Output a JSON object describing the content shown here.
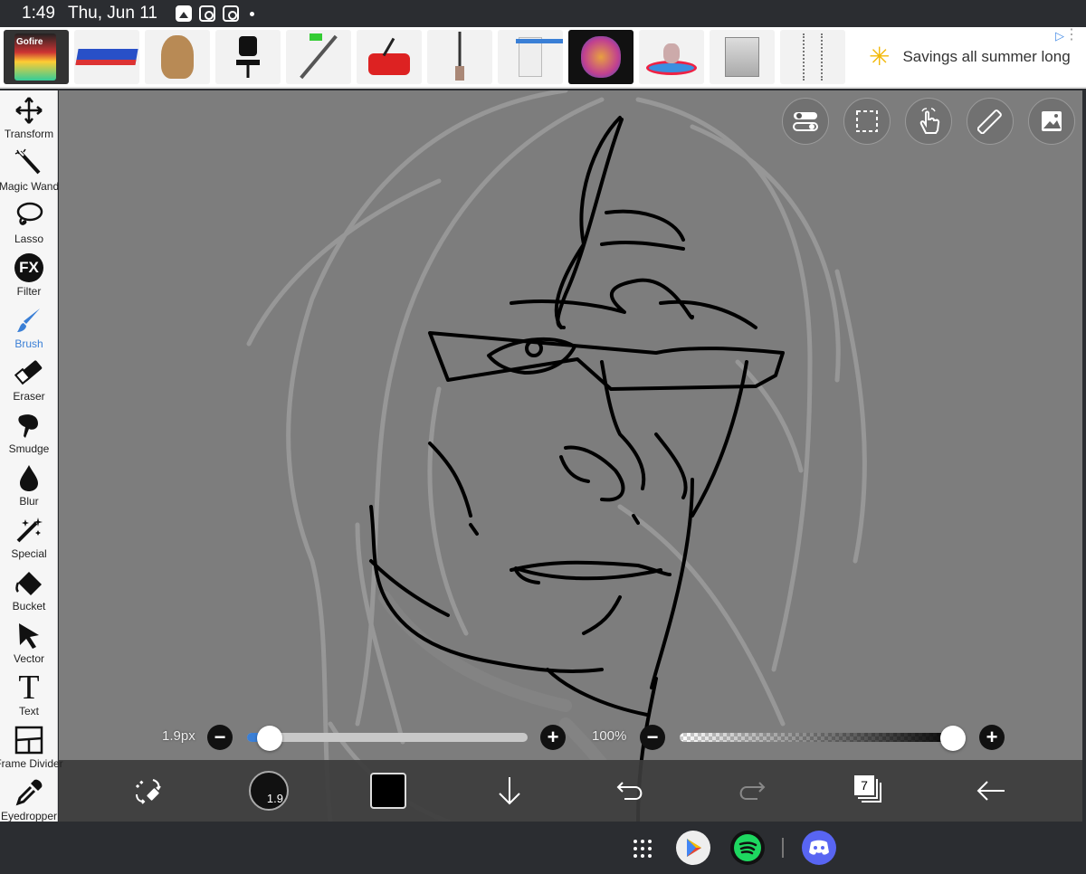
{
  "status_bar": {
    "time": "1:49",
    "date": "Thu, Jun 11",
    "icons": [
      "gallery-icon",
      "instagram-icon",
      "instagram-icon",
      "notification-dot-icon"
    ]
  },
  "ad_banner": {
    "products": [
      "phone-case-icon",
      "cot-icon",
      "dog-plush-icon",
      "office-chair-icon",
      "string-trimmer-icon",
      "lawn-mower-icon",
      "broom-icon",
      "water-dispenser-icon",
      "dog-art-icon",
      "swing-icon",
      "air-purifier-icon",
      "wind-chime-icon"
    ],
    "thumb_label": "Gofire",
    "slogan": "Savings all summer long",
    "brand_icon": "walmart-spark-icon",
    "info_icon": "ad-choices-icon"
  },
  "tools": [
    {
      "label": "Transform",
      "icon": "transform-icon"
    },
    {
      "label": "Magic Wand",
      "icon": "magic-wand-icon"
    },
    {
      "label": "Lasso",
      "icon": "lasso-icon"
    },
    {
      "label": "Filter",
      "icon": "fx-icon",
      "glyph": "FX"
    },
    {
      "label": "Brush",
      "icon": "brush-icon"
    },
    {
      "label": "Eraser",
      "icon": "eraser-icon"
    },
    {
      "label": "Smudge",
      "icon": "smudge-icon"
    },
    {
      "label": "Blur",
      "icon": "blur-drop-icon"
    },
    {
      "label": "Special",
      "icon": "special-icon"
    },
    {
      "label": "Bucket",
      "icon": "bucket-icon"
    },
    {
      "label": "Vector",
      "icon": "vector-arrow-icon"
    },
    {
      "label": "Text",
      "icon": "text-icon",
      "glyph": "T"
    },
    {
      "label": "Frame Divider",
      "icon": "frame-divider-icon"
    },
    {
      "label": "Eyedropper",
      "icon": "eyedropper-icon"
    }
  ],
  "active_tool": "Brush",
  "canvas_controls": [
    "toggle-icon",
    "selection-icon",
    "hand-touch-icon",
    "ruler-icon",
    "reference-image-icon"
  ],
  "brush_size": {
    "label": "1.9px",
    "value_fraction": 0.06
  },
  "opacity": {
    "label": "100%",
    "value_fraction": 1.0
  },
  "bottom_bar": {
    "brush_preview_value": "1.9",
    "color": "#000000",
    "layer_count": "7",
    "buttons": [
      "swap-eraser-icon",
      "brush-size-preview-icon",
      "color-swatch-icon",
      "download-arrow-icon",
      "undo-icon",
      "redo-icon",
      "layers-icon",
      "back-arrow-icon"
    ]
  },
  "nav_apps": [
    "app-grid-icon",
    "play-store-icon",
    "spotify-icon",
    "discord-icon"
  ],
  "colors": {
    "accent": "#3a7fd6",
    "canvas": "#7d7d7d",
    "ink": "#000000",
    "sketch": "#9a9a9a"
  }
}
